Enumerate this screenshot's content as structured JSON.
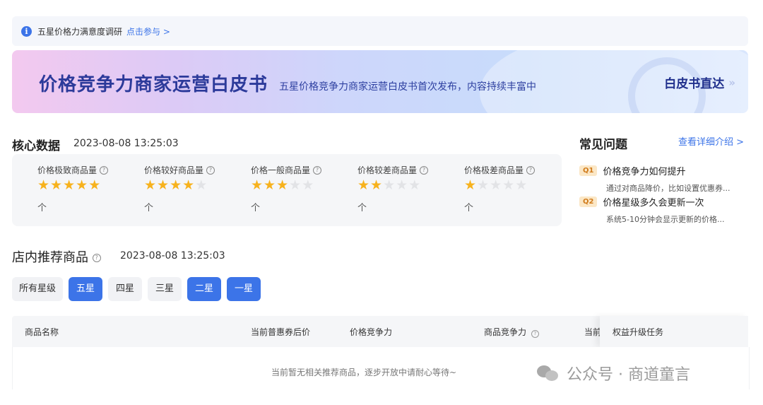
{
  "notice": {
    "text": "五星价格力满意度调研",
    "link": "点击参与 >",
    "icon": "info-icon"
  },
  "banner": {
    "title": "价格竞争力商家运营白皮书",
    "subtitle": "五星价格竞争力商家运营白皮书首次发布，内容持续丰富中",
    "cta": "白皮书直达",
    "cta_icon": "double-chevron-right-icon"
  },
  "core": {
    "title": "核心数据",
    "timestamp": "2023-08-08 13:25:03",
    "metrics": [
      {
        "label": "价格极致商品量",
        "stars": 5,
        "trend": "个"
      },
      {
        "label": "价格较好商品量",
        "stars": 4,
        "trend": "个"
      },
      {
        "label": "价格一般商品量",
        "stars": 3,
        "trend": "个"
      },
      {
        "label": "价格较差商品量",
        "stars": 2,
        "trend": "个"
      },
      {
        "label": "价格极差商品量",
        "stars": 1,
        "trend": "个"
      }
    ],
    "star_color": "#f7b21d"
  },
  "faq": {
    "title": "常见问题",
    "link": "查看详细介绍 >",
    "items": [
      {
        "badge": "Q1",
        "question": "价格竞争力如何提升",
        "answer": "通过对商品降价，比如设置优惠券..."
      },
      {
        "badge": "Q2",
        "question": "价格星级多久会更新一次",
        "answer": "系统5-10分钟会显示更新的价格..."
      }
    ]
  },
  "recommend": {
    "title": "店内推荐商品",
    "timestamp": "2023-08-08 13:25:03",
    "filters": [
      {
        "label": "所有星级",
        "active": false
      },
      {
        "label": "五星",
        "active": true
      },
      {
        "label": "四星",
        "active": false
      },
      {
        "label": "三星",
        "active": false
      },
      {
        "label": "二星",
        "active": true
      },
      {
        "label": "一星",
        "active": true
      }
    ],
    "columns": [
      "商品名称",
      "当前普惠券后价",
      "价格竞争力",
      "商品竞争力",
      "当前",
      "权益升级任务"
    ],
    "empty_text": "当前暂无相关推荐商品，逐步开放中请耐心等待~"
  },
  "watermark": {
    "text": "公众号 · 商道童言",
    "icon": "wechat-icon"
  },
  "colors": {
    "accent": "#3c74e8",
    "banner_title": "#2c3a9a"
  }
}
